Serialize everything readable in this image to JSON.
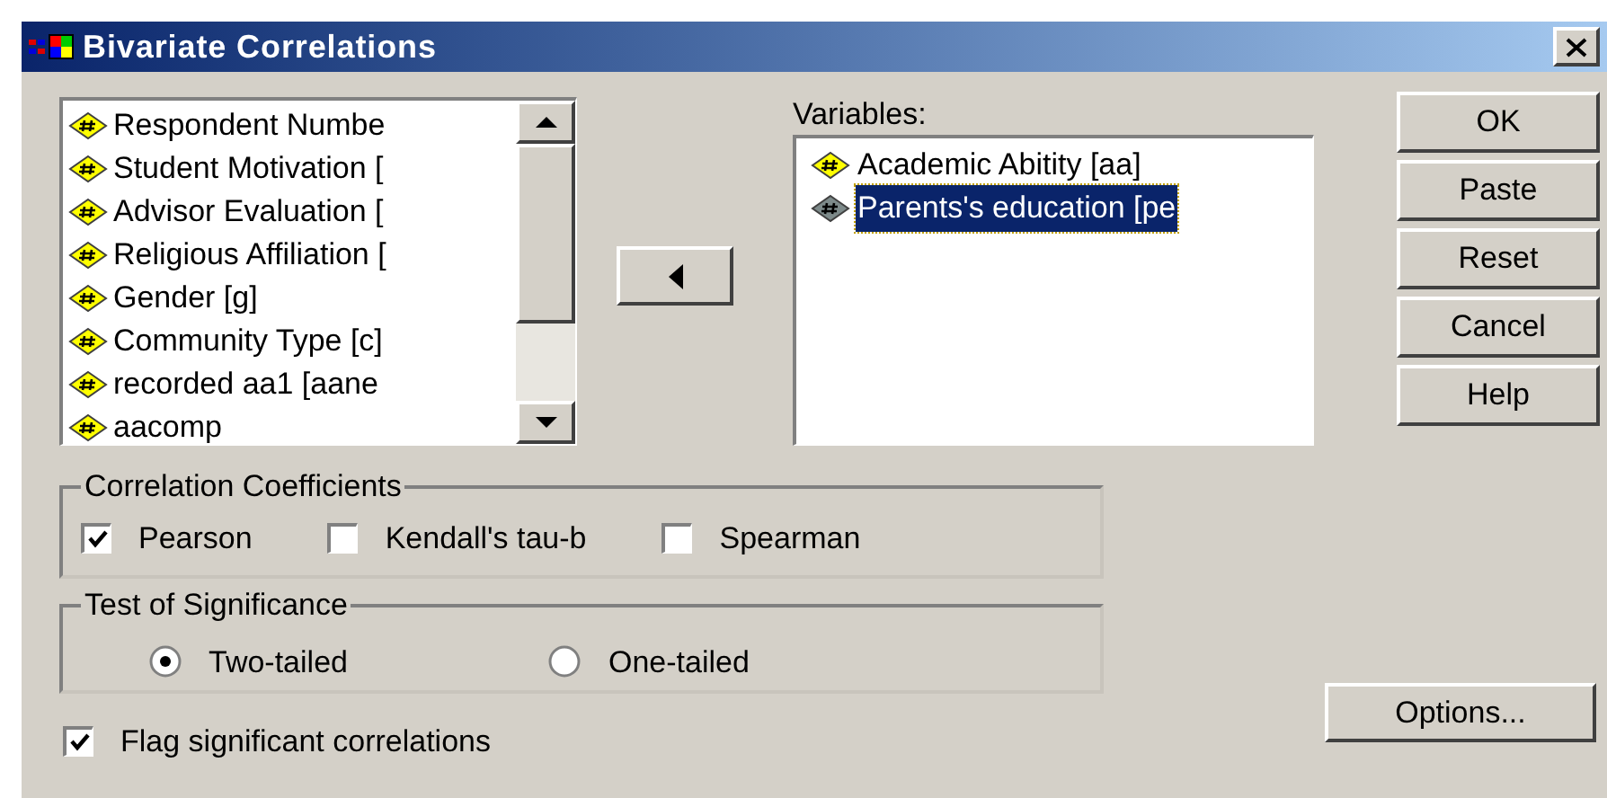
{
  "window": {
    "title": "Bivariate Correlations"
  },
  "source_list": {
    "items": [
      {
        "label": "Respondent Numbe",
        "selected": false
      },
      {
        "label": "Student Motivation [",
        "selected": false
      },
      {
        "label": "Advisor Evaluation [",
        "selected": false
      },
      {
        "label": "Religious Affiliation [",
        "selected": false
      },
      {
        "label": "Gender [g]",
        "selected": false
      },
      {
        "label": "Community Type [c]",
        "selected": false
      },
      {
        "label": "recorded aa1 [aane",
        "selected": false
      },
      {
        "label": "aacomp",
        "selected": false
      }
    ]
  },
  "variables": {
    "label": "Variables:",
    "items": [
      {
        "label": "Academic Abitity [aa]",
        "selected": false
      },
      {
        "label": "Parents's education [pe",
        "selected": true
      }
    ]
  },
  "buttons": [
    "OK",
    "Paste",
    "Reset",
    "Cancel",
    "Help"
  ],
  "correlation_coefficients": {
    "title": "Correlation Coefficients",
    "options": [
      {
        "label": "Pearson",
        "checked": true
      },
      {
        "label": "Kendall's tau-b",
        "checked": false
      },
      {
        "label": "Spearman",
        "checked": false
      }
    ]
  },
  "test_of_significance": {
    "title": "Test of Significance",
    "options": [
      {
        "label": "Two-tailed",
        "selected": true
      },
      {
        "label": "One-tailed",
        "selected": false
      }
    ]
  },
  "flag": {
    "label": "Flag significant correlations",
    "checked": true
  },
  "options_button": "Options..."
}
